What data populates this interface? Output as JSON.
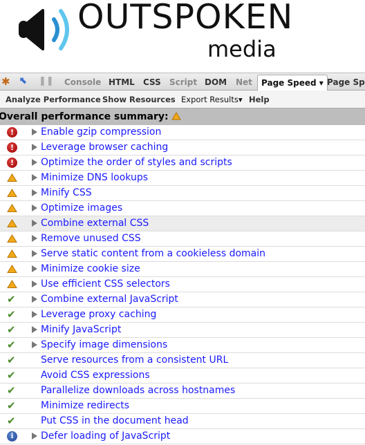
{
  "logo": {
    "word1": "OUTSPOKEN",
    "word2": "media",
    "colors": {
      "speaker": "#111111",
      "wave_inner": "#2a8fd0",
      "wave_outer": "#5fc6ee"
    }
  },
  "toolbar": {
    "tabs": [
      {
        "label": "Console",
        "state": "dim"
      },
      {
        "label": "HTML",
        "state": "on"
      },
      {
        "label": "CSS",
        "state": "on"
      },
      {
        "label": "Script",
        "state": "dim"
      },
      {
        "label": "DOM",
        "state": "on"
      },
      {
        "label": "Net",
        "state": "dim"
      },
      {
        "label": "Page Speed ▾",
        "state": "selected"
      },
      {
        "label": "Page Speed",
        "state": "on"
      }
    ],
    "icons": [
      "firebug-icon",
      "inspect-icon",
      "pause-icon"
    ]
  },
  "subtoolbar": {
    "items": [
      "Analyze Performance",
      "Show Resources",
      "Export Results▾",
      "Help"
    ]
  },
  "summary": {
    "label": "Overall performance summary:",
    "status": "warning"
  },
  "rules": [
    {
      "label": "Enable gzip compression",
      "status": "error",
      "expandable": true
    },
    {
      "label": "Leverage browser caching",
      "status": "error",
      "expandable": true
    },
    {
      "label": "Optimize the order of styles and scripts",
      "status": "error",
      "expandable": true
    },
    {
      "label": "Minimize DNS lookups",
      "status": "warning",
      "expandable": true
    },
    {
      "label": "Minify CSS",
      "status": "warning",
      "expandable": true
    },
    {
      "label": "Optimize images",
      "status": "warning",
      "expandable": true
    },
    {
      "label": "Combine external CSS",
      "status": "warning",
      "expandable": true,
      "highlighted": true
    },
    {
      "label": "Remove unused CSS",
      "status": "warning",
      "expandable": true
    },
    {
      "label": "Serve static content from a cookieless domain",
      "status": "warning",
      "expandable": true
    },
    {
      "label": "Minimize cookie size",
      "status": "warning",
      "expandable": true
    },
    {
      "label": "Use efficient CSS selectors",
      "status": "warning",
      "expandable": true
    },
    {
      "label": "Combine external JavaScript",
      "status": "pass",
      "expandable": true
    },
    {
      "label": "Leverage proxy caching",
      "status": "pass",
      "expandable": true
    },
    {
      "label": "Minify JavaScript",
      "status": "pass",
      "expandable": true
    },
    {
      "label": "Specify image dimensions",
      "status": "pass",
      "expandable": true
    },
    {
      "label": "Serve resources from a consistent URL",
      "status": "pass",
      "expandable": false
    },
    {
      "label": "Avoid CSS expressions",
      "status": "pass",
      "expandable": false
    },
    {
      "label": "Parallelize downloads across hostnames",
      "status": "pass",
      "expandable": false
    },
    {
      "label": "Minimize redirects",
      "status": "pass",
      "expandable": false
    },
    {
      "label": "Put CSS in the document head",
      "status": "pass",
      "expandable": false
    },
    {
      "label": "Defer loading of JavaScript",
      "status": "info",
      "expandable": true
    }
  ]
}
